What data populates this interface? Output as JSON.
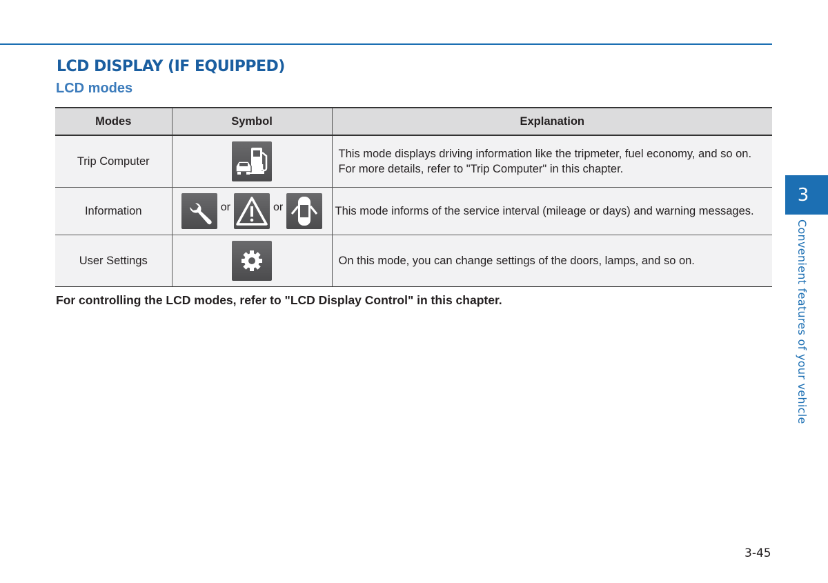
{
  "header": {
    "section_title": "LCD DISPLAY (IF EQUIPPED)",
    "subsection_title": "LCD modes"
  },
  "table": {
    "columns": [
      "Modes",
      "Symbol",
      "Explanation"
    ],
    "rows": [
      {
        "mode": "Trip Computer",
        "symbols": [
          "fuel-pump-car-icon"
        ],
        "explanation_lines": [
          "This mode displays driving information like the tripmeter, fuel economy, and so on.",
          "For more details, refer to \"Trip Computer\" in this chapter."
        ]
      },
      {
        "mode": "Information",
        "symbols": [
          "wrench-icon",
          "warning-triangle-icon",
          "car-doors-open-icon"
        ],
        "separator": "or",
        "explanation_lines": [
          "This mode informs of the service interval (mileage or days) and warning messages."
        ]
      },
      {
        "mode": "User Settings",
        "symbols": [
          "gear-icon"
        ],
        "explanation_lines": [
          "On this mode, you can change settings of the doors, lamps, and so on."
        ]
      }
    ]
  },
  "note": "For controlling the LCD modes, refer to \"LCD Display Control\" in this chapter.",
  "side_tab": {
    "chapter_number": "3",
    "chapter_title": "Convenient features of your vehicle"
  },
  "footer": {
    "page_number": "3-45"
  },
  "colors": {
    "accent": "#1c6fb3",
    "title": "#1a5ea0",
    "header_bg": "#dcdcdd",
    "cell_bg": "#f2f2f3",
    "icon_bg": "#5a5a5c"
  }
}
